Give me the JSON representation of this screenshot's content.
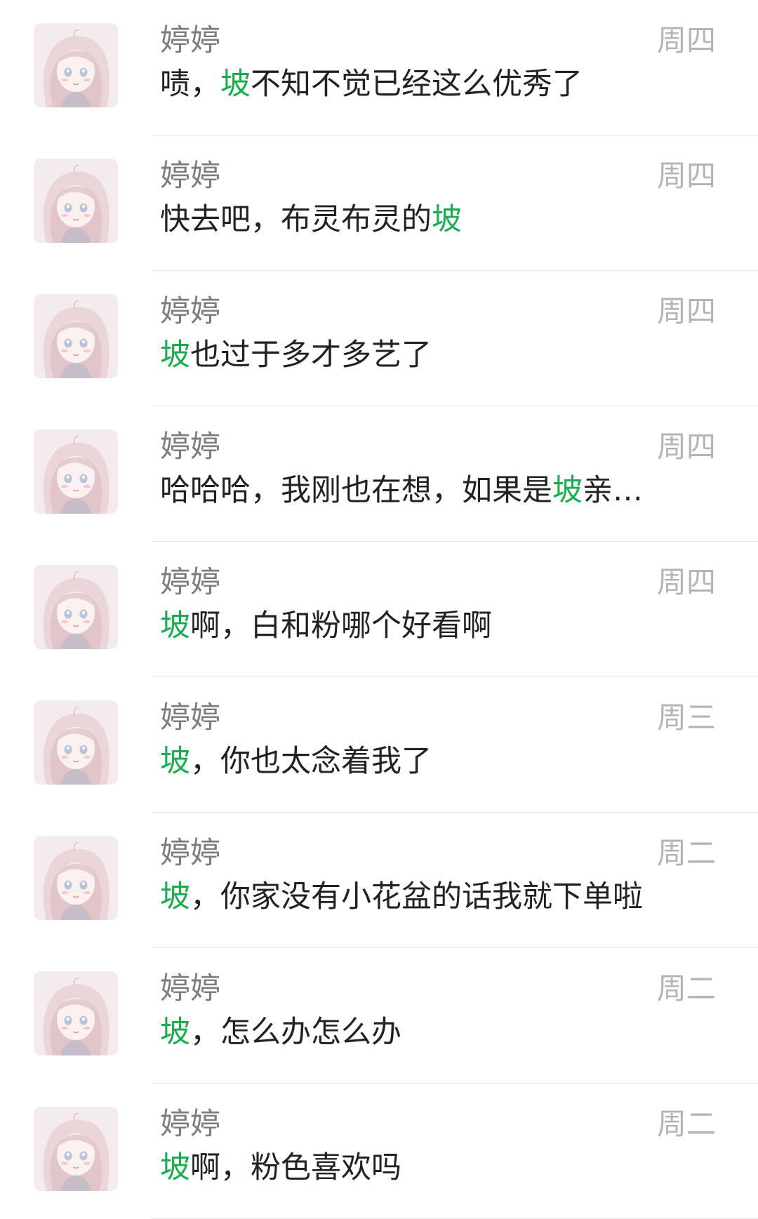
{
  "theme": {
    "highlight_color": "#1aad4e",
    "name_color": "#7d7d7d",
    "time_color": "#b5b5b5",
    "message_color": "#222222"
  },
  "results": [
    {
      "avatar_icon": "anime-girl-avatar",
      "name": "婷婷",
      "time": "周四",
      "msg_before": "啧，",
      "keyword": "坡",
      "msg_after": "不知不觉已经这么优秀了"
    },
    {
      "avatar_icon": "anime-girl-avatar",
      "name": "婷婷",
      "time": "周四",
      "msg_before": "快去吧，布灵布灵的",
      "keyword": "坡",
      "msg_after": ""
    },
    {
      "avatar_icon": "anime-girl-avatar",
      "name": "婷婷",
      "time": "周四",
      "msg_before": "",
      "keyword": "坡",
      "msg_after": "也过于多才多艺了"
    },
    {
      "avatar_icon": "anime-girl-avatar",
      "name": "婷婷",
      "time": "周四",
      "msg_before": "哈哈哈，我刚也在想，如果是",
      "keyword": "坡",
      "msg_after": "亲…"
    },
    {
      "avatar_icon": "anime-girl-avatar",
      "name": "婷婷",
      "time": "周四",
      "msg_before": "",
      "keyword": "坡",
      "msg_after": "啊，白和粉哪个好看啊"
    },
    {
      "avatar_icon": "anime-girl-avatar",
      "name": "婷婷",
      "time": "周三",
      "msg_before": "",
      "keyword": "坡",
      "msg_after": "，你也太念着我了"
    },
    {
      "avatar_icon": "anime-girl-avatar",
      "name": "婷婷",
      "time": "周二",
      "msg_before": "",
      "keyword": "坡",
      "msg_after": "，你家没有小花盆的话我就下单啦"
    },
    {
      "avatar_icon": "anime-girl-avatar",
      "name": "婷婷",
      "time": "周二",
      "msg_before": "",
      "keyword": "坡",
      "msg_after": "，怎么办怎么办"
    },
    {
      "avatar_icon": "anime-girl-avatar",
      "name": "婷婷",
      "time": "周二",
      "msg_before": "",
      "keyword": "坡",
      "msg_after": "啊，粉色喜欢吗"
    }
  ]
}
